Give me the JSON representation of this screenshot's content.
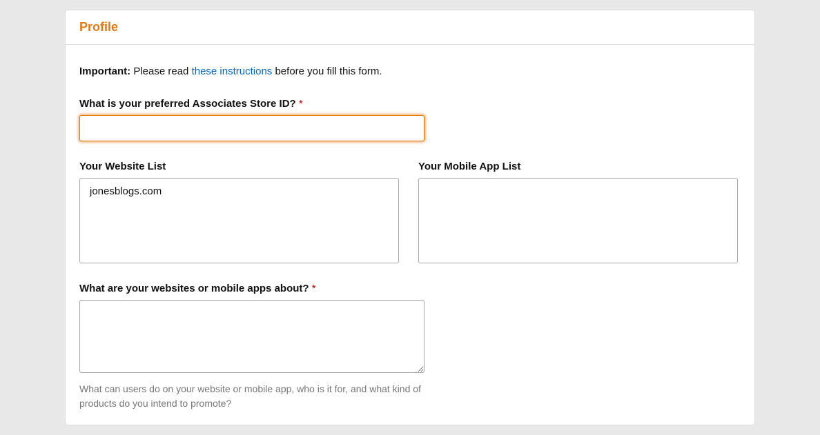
{
  "header": {
    "title": "Profile"
  },
  "important": {
    "prefix": "Important:",
    "before": " Please read ",
    "link": "these instructions",
    "after": " before you fill this form."
  },
  "storeId": {
    "label": "What is your preferred Associates Store ID? ",
    "required": "*",
    "value": ""
  },
  "websiteList": {
    "label": "Your Website List",
    "value": "jonesblogs.com"
  },
  "mobileAppList": {
    "label": "Your Mobile App List",
    "value": ""
  },
  "about": {
    "label": "What are your websites or mobile apps about? ",
    "required": "*",
    "value": "",
    "help": "What can users do on your website or mobile app, who is it for, and what kind of products do you intend to promote?"
  }
}
